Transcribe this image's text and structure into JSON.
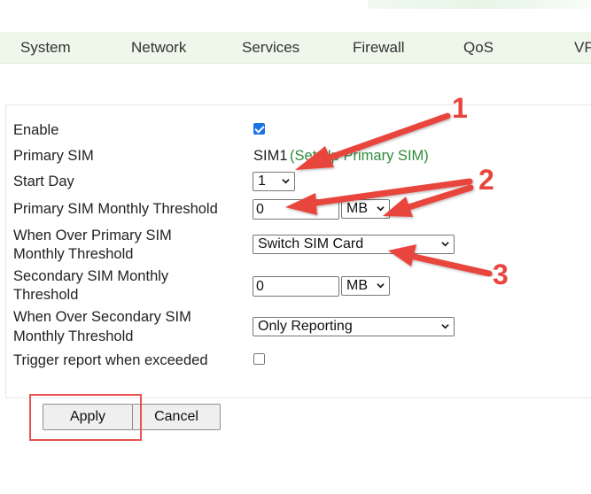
{
  "nav": {
    "items": [
      "System",
      "Network",
      "Services",
      "Firewall",
      "QoS",
      "VPN"
    ]
  },
  "form": {
    "enable": {
      "label": "Enable",
      "checked": true
    },
    "primary_sim": {
      "label": "Primary SIM",
      "value_prefix": "SIM1",
      "value_suffix": "(Set Up Primary SIM)"
    },
    "start_day": {
      "label": "Start Day",
      "value": "1"
    },
    "primary_threshold": {
      "label": "Primary SIM Monthly Threshold",
      "value": "0",
      "unit": "MB"
    },
    "over_primary": {
      "label_line1": "When Over Primary SIM",
      "label_line2": "Monthly Threshold",
      "value": "Switch SIM Card"
    },
    "secondary_threshold": {
      "label_line1": "Secondary SIM Monthly",
      "label_line2": "Threshold",
      "value": "0",
      "unit": "MB"
    },
    "over_secondary": {
      "label_line1": "When Over Secondary SIM",
      "label_line2": "Monthly Threshold",
      "value": "Only Reporting"
    },
    "trigger_report": {
      "label": "Trigger report when exceeded",
      "checked": false
    }
  },
  "buttons": {
    "apply": "Apply",
    "cancel": "Cancel"
  },
  "annotations": {
    "markers": [
      "1",
      "2",
      "3"
    ],
    "arrow_color": "#e8453c",
    "highlight_color": "#e8534f"
  },
  "colors": {
    "nav_bg": "#eef7ea",
    "link_green": "#2e8b3a",
    "checkbox_blue": "#1a73e8"
  }
}
